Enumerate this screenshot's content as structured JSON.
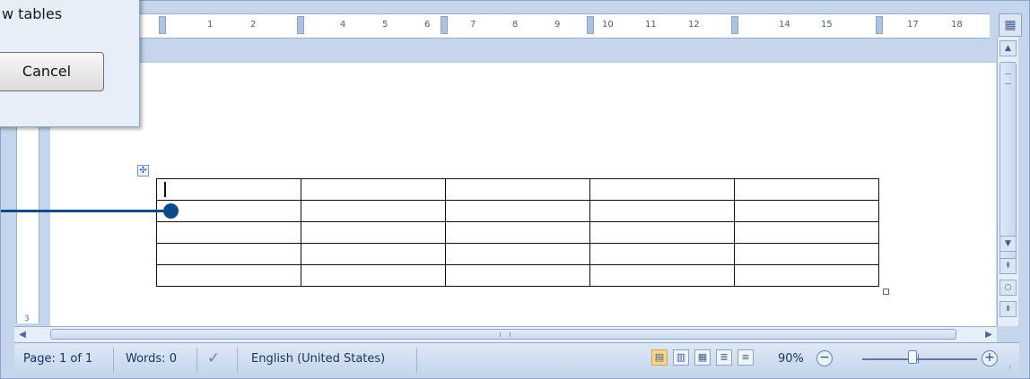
{
  "dialog": {
    "text": "w tables",
    "cancel_label": "Cancel"
  },
  "ruler": {
    "labels": [
      "1",
      "2",
      "4",
      "5",
      "6",
      "7",
      "8",
      "9",
      "10",
      "11",
      "12",
      "14",
      "15",
      "17",
      "18"
    ]
  },
  "vertical_ruler": {
    "label": "3"
  },
  "statusbar": {
    "page": "Page: 1 of 1",
    "words": "Words: 0",
    "language": "English (United States)",
    "zoom": "90%"
  },
  "table": {
    "rows": 5,
    "columns": 5
  },
  "icons": {
    "ruler_toggle": "ruler-toggle-icon",
    "proofing": "proofing-check-icon",
    "table_move": "table-move-handle-icon"
  }
}
